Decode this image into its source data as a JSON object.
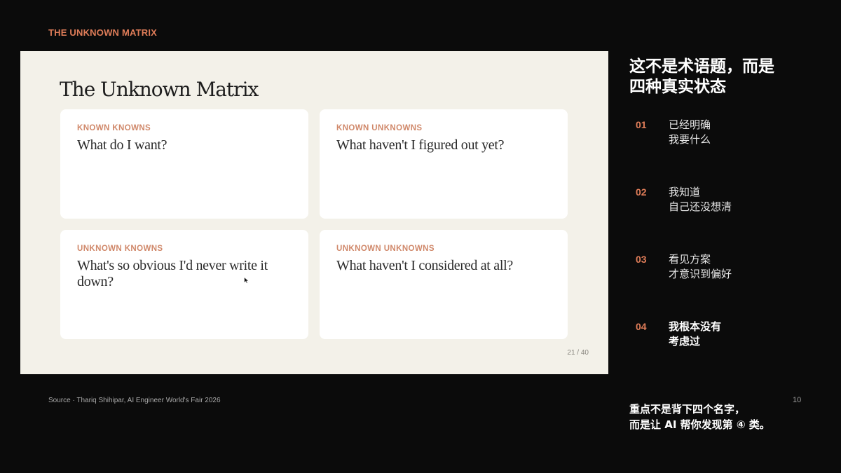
{
  "header": {
    "kicker": "THE UNKNOWN MATRIX"
  },
  "slide": {
    "title": "The Unknown Matrix",
    "page_indicator": "21 / 40",
    "cards": [
      {
        "label": "KNOWN KNOWNS",
        "question": "What do I want?"
      },
      {
        "label": "KNOWN UNKNOWNS",
        "question": "What haven't I figured out yet?"
      },
      {
        "label": "UNKNOWN KNOWNS",
        "question": "What's so obvious I'd never write it down?"
      },
      {
        "label": "UNKNOWN UNKNOWNS",
        "question": "What haven't I considered at all?"
      }
    ]
  },
  "panel": {
    "title": "这不是术语题，而是\n四种真实状态",
    "items": [
      {
        "number": "01",
        "text": "已经明确\n我要什么"
      },
      {
        "number": "02",
        "text": "我知道\n自己还没想清"
      },
      {
        "number": "03",
        "text": "看见方案\n才意识到偏好"
      },
      {
        "number": "04",
        "text": "我根本没有\n考虑过"
      }
    ],
    "takeaway": "重点不是背下四个名字，\n而是让 AI 帮你发现第 ④ 类。"
  },
  "footer": {
    "source": "Source · Thariq Shihipar, AI Engineer World's Fair 2026",
    "page_number": "10"
  },
  "colors": {
    "accent": "#e07d59",
    "card_label": "#d0886a",
    "slide_bg": "#f3f1e9",
    "page_bg": "#0b0b0b"
  }
}
